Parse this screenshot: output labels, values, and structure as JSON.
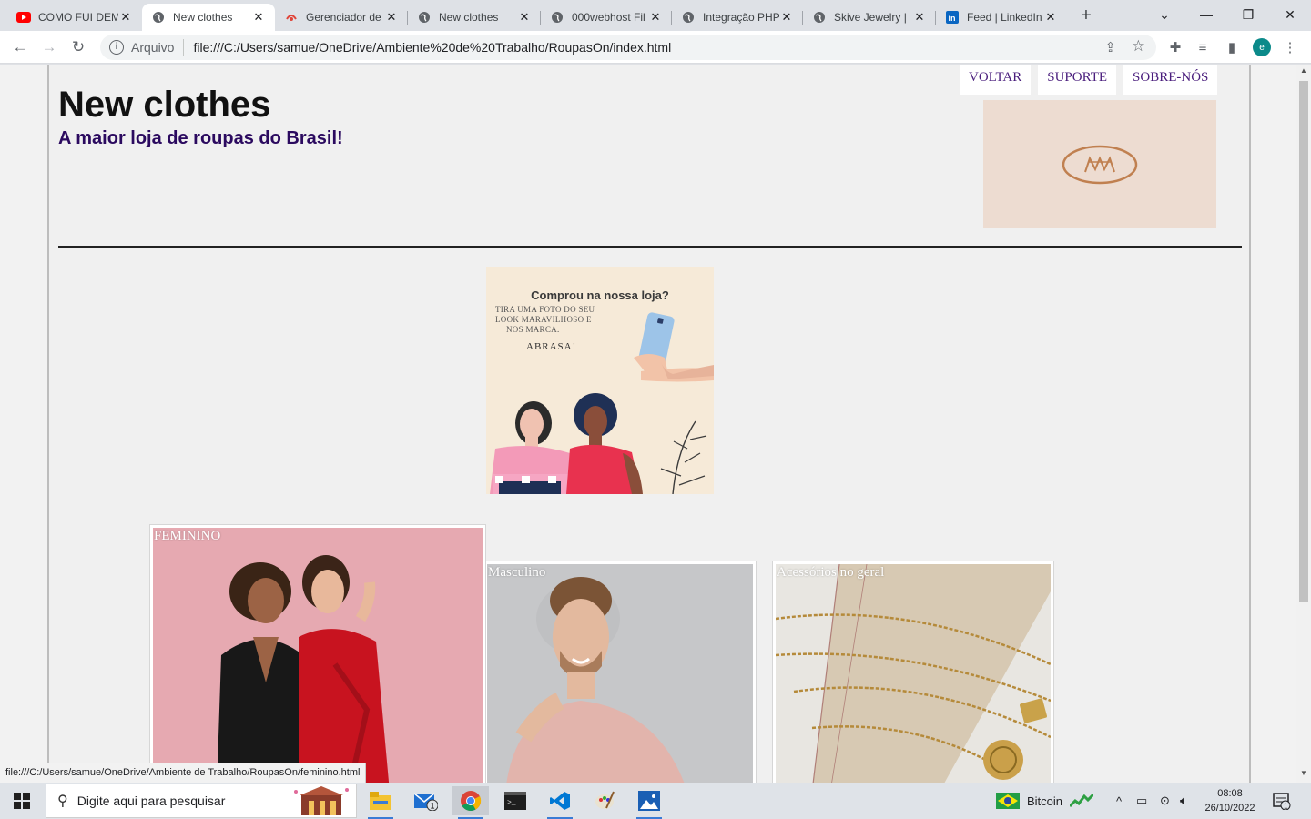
{
  "browser": {
    "tabs": [
      {
        "title": "COMO FUI DEM",
        "icon": "youtube-icon",
        "active": false
      },
      {
        "title": "New clothes",
        "icon": "globe-icon",
        "active": true
      },
      {
        "title": "Gerenciador de",
        "icon": "manager-icon",
        "active": false
      },
      {
        "title": "New clothes",
        "icon": "globe-icon",
        "active": false
      },
      {
        "title": "000webhost Fil",
        "icon": "globe-icon",
        "active": false
      },
      {
        "title": "Integração PHP",
        "icon": "globe-icon",
        "active": false
      },
      {
        "title": "Skive Jewelry |",
        "icon": "globe-icon",
        "active": false
      },
      {
        "title": "Feed | LinkedIn",
        "icon": "linkedin-icon",
        "active": false
      }
    ],
    "address": {
      "scheme_label": "Arquivo",
      "url": "file:///C:/Users/samue/OneDrive/Ambiente%20de%20Trabalho/RoupasOn/index.html"
    },
    "profile_initial": "e",
    "status_url": "file:///C:/Users/samue/OneDrive/Ambiente de Trabalho/RoupasOn/feminino.html"
  },
  "site": {
    "title": "New clothes",
    "subtitle": "A maior loja de roupas do Brasil!",
    "nav": [
      {
        "label": "VOLTAR"
      },
      {
        "label": "SUPORTE"
      },
      {
        "label": "SOBRE-NÓS"
      }
    ],
    "promo": {
      "title": "Comprou na nossa loja?",
      "lines": [
        "TIRA UMA FOTO DO SEU",
        "LOOK MARAVILHOSO E",
        "NOS MARCA."
      ],
      "tagline": "ABRASA!",
      "slide_count": 3
    },
    "categories": [
      {
        "label": "FEMININO"
      },
      {
        "label": "Masculino"
      },
      {
        "label": "Acessórios no geral"
      }
    ]
  },
  "taskbar": {
    "search_placeholder": "Digite aqui para pesquisar",
    "tray_item": "Bitcoin",
    "time": "08:08",
    "date": "26/10/2022",
    "mail_badge": "1",
    "notif_badge": "1"
  },
  "colors": {
    "accent_nav": "#4a1e7d",
    "subtitle": "#2b0a5f",
    "logo_bg": "#eddcd1",
    "logo_mark": "#c08050"
  }
}
